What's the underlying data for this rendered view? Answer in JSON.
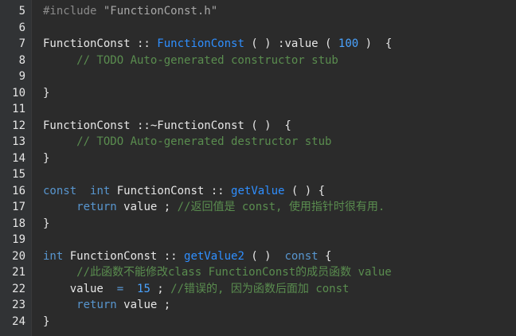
{
  "line_numbers": [
    "5",
    "6",
    "7",
    "8",
    "9",
    "10",
    "11",
    "12",
    "13",
    "14",
    "15",
    "16",
    "17",
    "18",
    "19",
    "20",
    "21",
    "22",
    "23",
    "24"
  ],
  "lines": [
    {
      "tokens": [
        {
          "t": "#include ",
          "c": "pp"
        },
        {
          "t": "\"FunctionConst.h\"",
          "c": "str"
        }
      ]
    },
    {
      "tokens": []
    },
    {
      "tokens": [
        {
          "t": "FunctionConst :: ",
          "c": "tx"
        },
        {
          "t": "FunctionConst",
          "c": "fn"
        },
        {
          "t": " ( ) :value ( ",
          "c": "tx"
        },
        {
          "t": "100",
          "c": "num"
        },
        {
          "t": " )  {",
          "c": "tx"
        }
      ]
    },
    {
      "tokens": [
        {
          "t": "     // TODO Auto-generated constructor stub",
          "c": "cm"
        }
      ]
    },
    {
      "tokens": []
    },
    {
      "tokens": [
        {
          "t": "}",
          "c": "tx"
        }
      ]
    },
    {
      "tokens": []
    },
    {
      "tokens": [
        {
          "t": "FunctionConst ::~FunctionConst ( )  {",
          "c": "tx"
        }
      ]
    },
    {
      "tokens": [
        {
          "t": "     // TODO Auto-generated destructor stub",
          "c": "cm"
        }
      ]
    },
    {
      "tokens": [
        {
          "t": "}",
          "c": "tx"
        }
      ]
    },
    {
      "tokens": []
    },
    {
      "tokens": [
        {
          "t": "const",
          "c": "kw"
        },
        {
          "t": "  ",
          "c": "tx"
        },
        {
          "t": "int",
          "c": "kw"
        },
        {
          "t": " FunctionConst :: ",
          "c": "tx"
        },
        {
          "t": "getValue",
          "c": "fn"
        },
        {
          "t": " ( ) {",
          "c": "tx"
        }
      ]
    },
    {
      "tokens": [
        {
          "t": "     ",
          "c": "tx"
        },
        {
          "t": "return",
          "c": "kw"
        },
        {
          "t": " value ; ",
          "c": "tx"
        },
        {
          "t": "//返回值是 const, 使用指针时很有用.",
          "c": "cm"
        }
      ]
    },
    {
      "tokens": [
        {
          "t": "}",
          "c": "tx"
        }
      ]
    },
    {
      "tokens": []
    },
    {
      "tokens": [
        {
          "t": "int",
          "c": "kw"
        },
        {
          "t": " FunctionConst :: ",
          "c": "tx"
        },
        {
          "t": "getValue2",
          "c": "fn"
        },
        {
          "t": " ( )  ",
          "c": "tx"
        },
        {
          "t": "const",
          "c": "kw"
        },
        {
          "t": " {",
          "c": "tx"
        }
      ]
    },
    {
      "tokens": [
        {
          "t": "     //此函数不能修改class FunctionConst的成员函数 value",
          "c": "cm"
        }
      ]
    },
    {
      "tokens": [
        {
          "t": "    value  ",
          "c": "tx"
        },
        {
          "t": "=",
          "c": "kw"
        },
        {
          "t": "  ",
          "c": "tx"
        },
        {
          "t": "15",
          "c": "num"
        },
        {
          "t": " ; ",
          "c": "tx"
        },
        {
          "t": "//错误的, 因为函数后面加 const",
          "c": "cm"
        }
      ]
    },
    {
      "tokens": [
        {
          "t": "     ",
          "c": "tx"
        },
        {
          "t": "return",
          "c": "kw"
        },
        {
          "t": " value ;",
          "c": "tx"
        }
      ]
    },
    {
      "tokens": [
        {
          "t": "}",
          "c": "tx"
        }
      ]
    }
  ],
  "colors": {
    "background": "#2b2b2b",
    "gutter": "#313335",
    "keyword": "#5896cf",
    "function": "#2f8fff",
    "number": "#4aa3ff",
    "comment": "#5a8d4f"
  }
}
